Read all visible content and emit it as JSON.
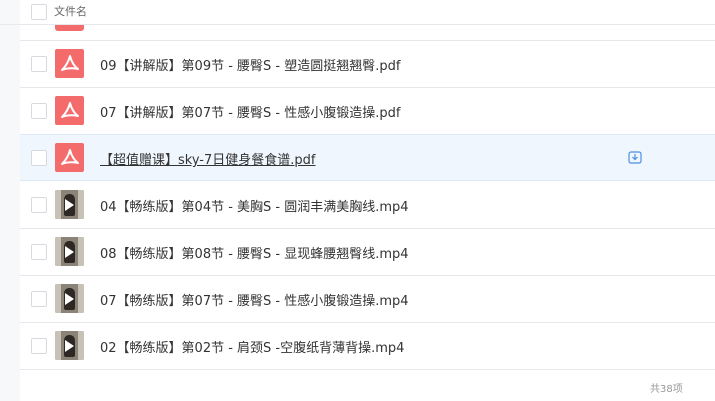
{
  "header": {
    "column_label": "文件名"
  },
  "files": [
    {
      "name": "09【讲解版】第09节 - 腰臀S - 塑造圆挺翘翘臀.pdf",
      "icon": "pdf-icon"
    },
    {
      "name": "07【讲解版】第07节 - 腰臀S - 性感小腹锻造操.pdf",
      "icon": "pdf-icon"
    },
    {
      "name": "【超值赠课】sky-7日健身餐食谱.pdf",
      "icon": "pdf-icon"
    },
    {
      "name": "04【畅练版】第04节 - 美胸S - 圆润丰满美胸线.mp4",
      "icon": "video-thumbnail"
    },
    {
      "name": "08【畅练版】第08节 - 腰臀S - 显现蜂腰翘臀线.mp4",
      "icon": "video-thumbnail"
    },
    {
      "name": "07【畅练版】第07节 - 腰臀S - 性感小腹锻造操.mp4",
      "icon": "video-thumbnail"
    },
    {
      "name": "02【畅练版】第02节 - 肩颈S -空腹纸背薄背操.mp4",
      "icon": "video-thumbnail"
    }
  ],
  "footer": {
    "count": "共38项"
  },
  "colors": {
    "pdf_icon": "#f46b6b",
    "highlight_row": "#f0f6fd",
    "download_icon": "#4a90e2"
  }
}
